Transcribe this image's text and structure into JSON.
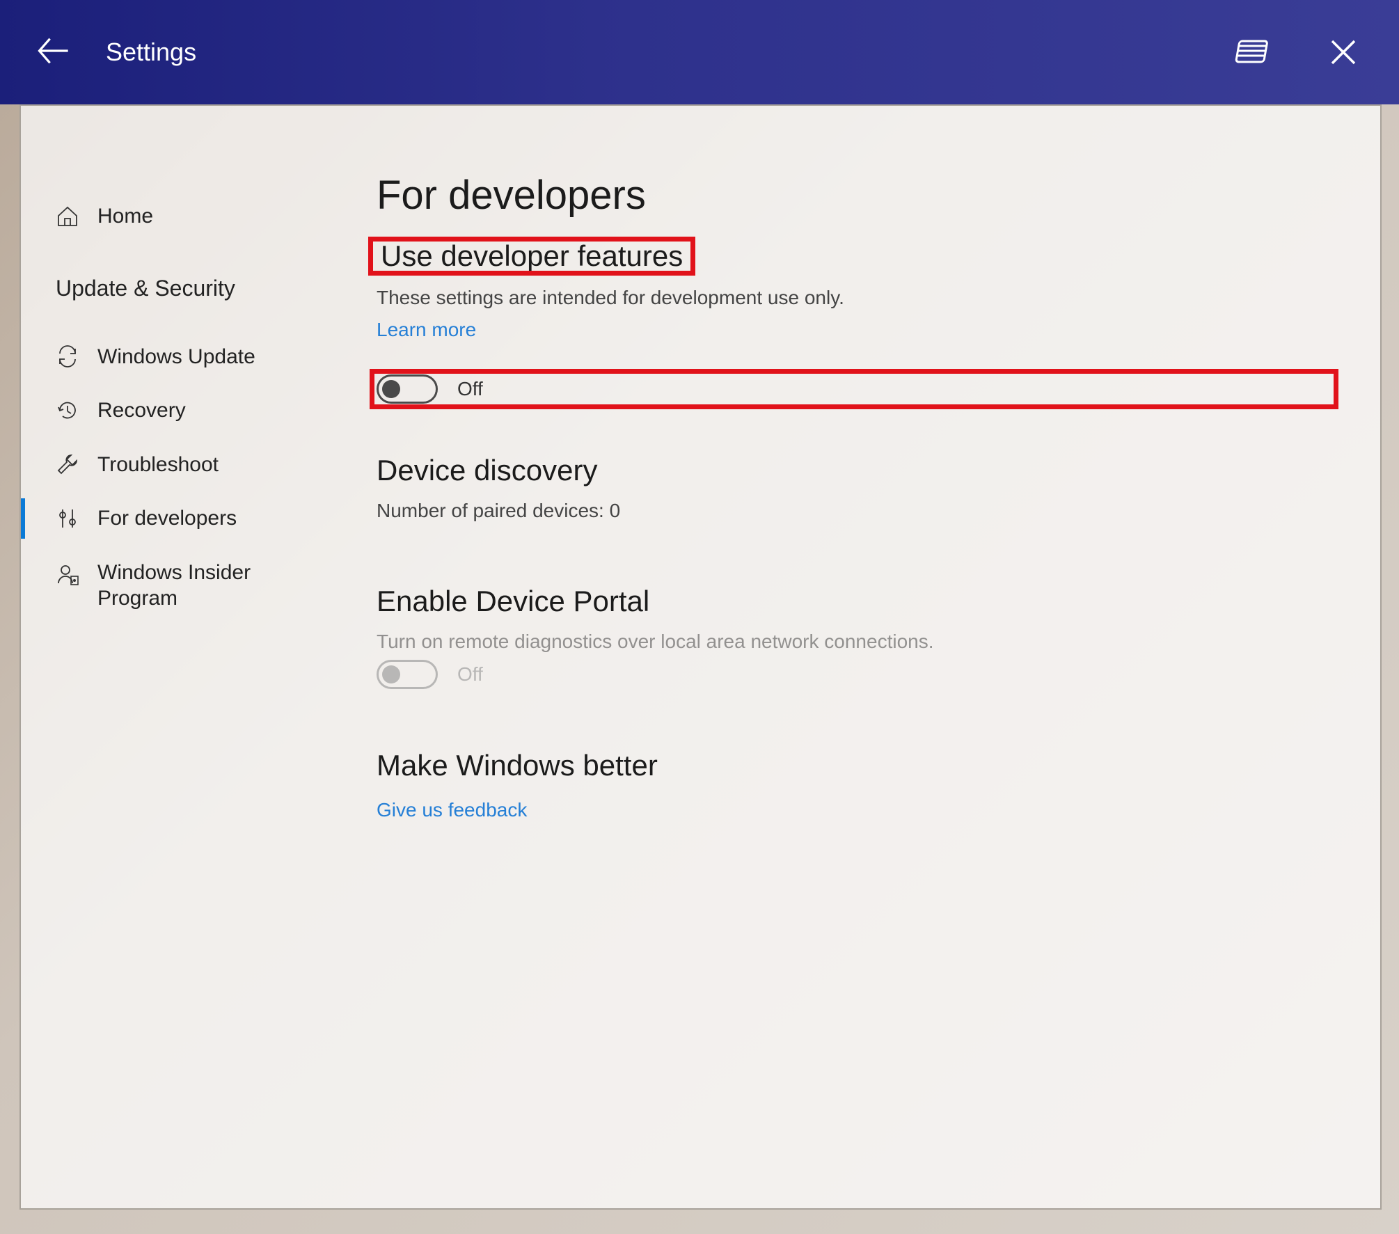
{
  "titlebar": {
    "title": "Settings"
  },
  "sidebar": {
    "home": "Home",
    "category": "Update & Security",
    "windows_update": "Windows Update",
    "recovery": "Recovery",
    "troubleshoot": "Troubleshoot",
    "for_developers": "For developers",
    "insider_line1": "Windows Insider",
    "insider_line2": "Program"
  },
  "main": {
    "page_title": "For developers",
    "dev_features": {
      "heading": "Use developer features",
      "body": "These settings are intended for development use only.",
      "learn_more": "Learn more",
      "toggle_label": "Off"
    },
    "device_discovery": {
      "heading": "Device discovery",
      "body": "Number of paired devices: 0"
    },
    "device_portal": {
      "heading": "Enable Device Portal",
      "body": "Turn on remote diagnostics over local area network connections.",
      "toggle_label": "Off"
    },
    "make_better": {
      "heading": "Make Windows better",
      "feedback": "Give us feedback"
    }
  },
  "colors": {
    "accent": "#0b7ad6",
    "link": "#257fd6",
    "callout": "#e1121a"
  }
}
